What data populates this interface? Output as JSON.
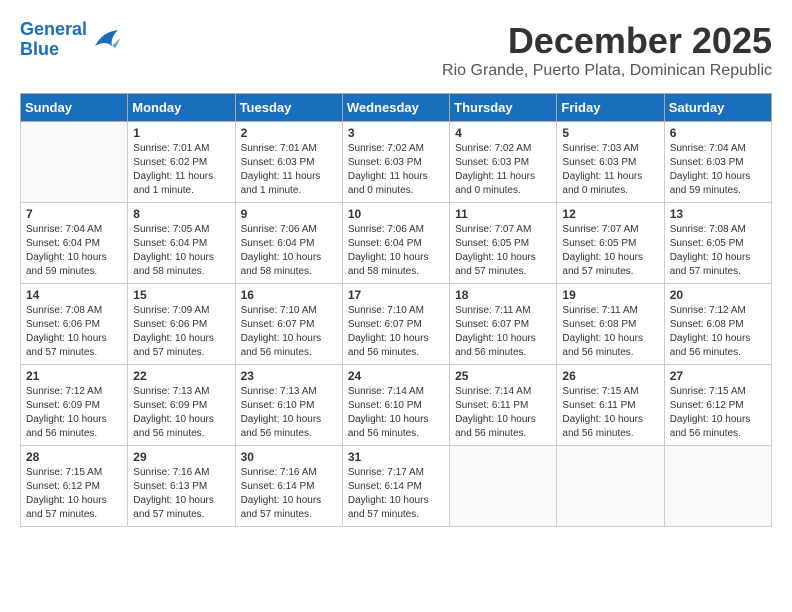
{
  "header": {
    "logo_line1": "General",
    "logo_line2": "Blue",
    "month_title": "December 2025",
    "location": "Rio Grande, Puerto Plata, Dominican Republic"
  },
  "weekdays": [
    "Sunday",
    "Monday",
    "Tuesday",
    "Wednesday",
    "Thursday",
    "Friday",
    "Saturday"
  ],
  "weeks": [
    [
      {
        "day": "",
        "info": ""
      },
      {
        "day": "1",
        "info": "Sunrise: 7:01 AM\nSunset: 6:02 PM\nDaylight: 11 hours\nand 1 minute."
      },
      {
        "day": "2",
        "info": "Sunrise: 7:01 AM\nSunset: 6:03 PM\nDaylight: 11 hours\nand 1 minute."
      },
      {
        "day": "3",
        "info": "Sunrise: 7:02 AM\nSunset: 6:03 PM\nDaylight: 11 hours\nand 0 minutes."
      },
      {
        "day": "4",
        "info": "Sunrise: 7:02 AM\nSunset: 6:03 PM\nDaylight: 11 hours\nand 0 minutes."
      },
      {
        "day": "5",
        "info": "Sunrise: 7:03 AM\nSunset: 6:03 PM\nDaylight: 11 hours\nand 0 minutes."
      },
      {
        "day": "6",
        "info": "Sunrise: 7:04 AM\nSunset: 6:03 PM\nDaylight: 10 hours\nand 59 minutes."
      }
    ],
    [
      {
        "day": "7",
        "info": "Sunrise: 7:04 AM\nSunset: 6:04 PM\nDaylight: 10 hours\nand 59 minutes."
      },
      {
        "day": "8",
        "info": "Sunrise: 7:05 AM\nSunset: 6:04 PM\nDaylight: 10 hours\nand 58 minutes."
      },
      {
        "day": "9",
        "info": "Sunrise: 7:06 AM\nSunset: 6:04 PM\nDaylight: 10 hours\nand 58 minutes."
      },
      {
        "day": "10",
        "info": "Sunrise: 7:06 AM\nSunset: 6:04 PM\nDaylight: 10 hours\nand 58 minutes."
      },
      {
        "day": "11",
        "info": "Sunrise: 7:07 AM\nSunset: 6:05 PM\nDaylight: 10 hours\nand 57 minutes."
      },
      {
        "day": "12",
        "info": "Sunrise: 7:07 AM\nSunset: 6:05 PM\nDaylight: 10 hours\nand 57 minutes."
      },
      {
        "day": "13",
        "info": "Sunrise: 7:08 AM\nSunset: 6:05 PM\nDaylight: 10 hours\nand 57 minutes."
      }
    ],
    [
      {
        "day": "14",
        "info": "Sunrise: 7:08 AM\nSunset: 6:06 PM\nDaylight: 10 hours\nand 57 minutes."
      },
      {
        "day": "15",
        "info": "Sunrise: 7:09 AM\nSunset: 6:06 PM\nDaylight: 10 hours\nand 57 minutes."
      },
      {
        "day": "16",
        "info": "Sunrise: 7:10 AM\nSunset: 6:07 PM\nDaylight: 10 hours\nand 56 minutes."
      },
      {
        "day": "17",
        "info": "Sunrise: 7:10 AM\nSunset: 6:07 PM\nDaylight: 10 hours\nand 56 minutes."
      },
      {
        "day": "18",
        "info": "Sunrise: 7:11 AM\nSunset: 6:07 PM\nDaylight: 10 hours\nand 56 minutes."
      },
      {
        "day": "19",
        "info": "Sunrise: 7:11 AM\nSunset: 6:08 PM\nDaylight: 10 hours\nand 56 minutes."
      },
      {
        "day": "20",
        "info": "Sunrise: 7:12 AM\nSunset: 6:08 PM\nDaylight: 10 hours\nand 56 minutes."
      }
    ],
    [
      {
        "day": "21",
        "info": "Sunrise: 7:12 AM\nSunset: 6:09 PM\nDaylight: 10 hours\nand 56 minutes."
      },
      {
        "day": "22",
        "info": "Sunrise: 7:13 AM\nSunset: 6:09 PM\nDaylight: 10 hours\nand 56 minutes."
      },
      {
        "day": "23",
        "info": "Sunrise: 7:13 AM\nSunset: 6:10 PM\nDaylight: 10 hours\nand 56 minutes."
      },
      {
        "day": "24",
        "info": "Sunrise: 7:14 AM\nSunset: 6:10 PM\nDaylight: 10 hours\nand 56 minutes."
      },
      {
        "day": "25",
        "info": "Sunrise: 7:14 AM\nSunset: 6:11 PM\nDaylight: 10 hours\nand 56 minutes."
      },
      {
        "day": "26",
        "info": "Sunrise: 7:15 AM\nSunset: 6:11 PM\nDaylight: 10 hours\nand 56 minutes."
      },
      {
        "day": "27",
        "info": "Sunrise: 7:15 AM\nSunset: 6:12 PM\nDaylight: 10 hours\nand 56 minutes."
      }
    ],
    [
      {
        "day": "28",
        "info": "Sunrise: 7:15 AM\nSunset: 6:12 PM\nDaylight: 10 hours\nand 57 minutes."
      },
      {
        "day": "29",
        "info": "Sunrise: 7:16 AM\nSunset: 6:13 PM\nDaylight: 10 hours\nand 57 minutes."
      },
      {
        "day": "30",
        "info": "Sunrise: 7:16 AM\nSunset: 6:14 PM\nDaylight: 10 hours\nand 57 minutes."
      },
      {
        "day": "31",
        "info": "Sunrise: 7:17 AM\nSunset: 6:14 PM\nDaylight: 10 hours\nand 57 minutes."
      },
      {
        "day": "",
        "info": ""
      },
      {
        "day": "",
        "info": ""
      },
      {
        "day": "",
        "info": ""
      }
    ]
  ]
}
